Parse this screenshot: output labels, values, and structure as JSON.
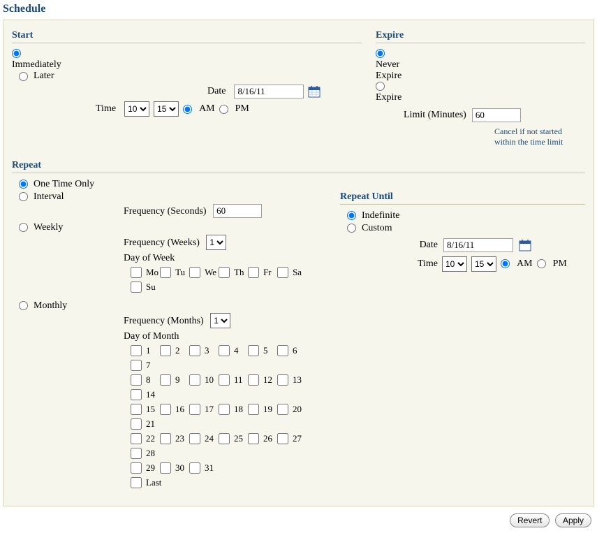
{
  "title": "Schedule",
  "start": {
    "heading": "Start",
    "immediately": "Immediately",
    "later": "Later",
    "date_label": "Date",
    "date_value": "8/16/11",
    "time_label": "Time",
    "hour": "10",
    "minute": "15",
    "am": "AM",
    "pm": "PM"
  },
  "expire": {
    "heading": "Expire",
    "never": "Never Expire",
    "expire": "Expire",
    "limit_label": "Limit (Minutes)",
    "limit_value": "60",
    "note": "Cancel if not started within the time limit"
  },
  "repeat": {
    "heading": "Repeat",
    "one_time": "One Time Only",
    "interval": "Interval",
    "freq_seconds_label": "Frequency (Seconds)",
    "freq_seconds_value": "60",
    "weekly": "Weekly",
    "freq_weeks_label": "Frequency (Weeks)",
    "freq_weeks_value": "1",
    "dow_label": "Day of Week",
    "dow": [
      "Mo",
      "Tu",
      "We",
      "Th",
      "Fr",
      "Sa",
      "Su"
    ],
    "monthly": "Monthly",
    "freq_months_label": "Frequency (Months)",
    "freq_months_value": "1",
    "dom_label": "Day of Month",
    "last": "Last"
  },
  "repeat_until": {
    "heading": "Repeat Until",
    "indefinite": "Indefinite",
    "custom": "Custom",
    "date_label": "Date",
    "date_value": "8/16/11",
    "time_label": "Time",
    "hour": "10",
    "minute": "15",
    "am": "AM",
    "pm": "PM"
  },
  "buttons": {
    "revert": "Revert",
    "apply": "Apply"
  }
}
